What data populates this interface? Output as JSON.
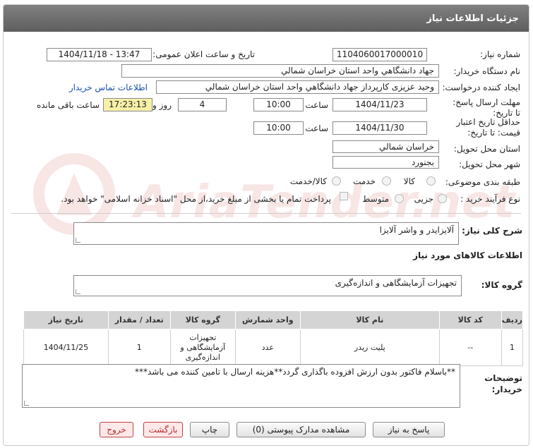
{
  "header": {
    "title": "جزئیات اطلاعات نیاز"
  },
  "fields": {
    "need_number_label": "شماره نیاز:",
    "need_number": "1104060017000010",
    "announce_label": "تاریخ و ساعت اعلان عمومی:",
    "announce_value": "1404/11/18 - 13:47",
    "buyer_org_label": "نام دستگاه خریدار:",
    "buyer_org": "جهاد دانشگاهي واحد استان خراسان شمالي",
    "creator_label": "ایجاد کننده درخواست:",
    "creator": "وحید عزیزی کارپرداز جهاد دانشگاهي واحد استان خراسان شمالي",
    "contact_link": "اطلاعات تماس خریدار",
    "deadline_label": "مهلت ارسال پاسخ: تا تاریخ:",
    "deadline_date": "1404/11/23",
    "time_label": "ساعت",
    "deadline_time": "10:00",
    "days": "4",
    "days_label": "روز و",
    "remaining": "17:23:13",
    "remaining_label": "ساعت باقی مانده",
    "min_validity_label": "حداقل تاریخ اعتبار قیمت: تا تاریخ:",
    "validity_date": "1404/11/30",
    "validity_time": "10:00",
    "province_label": "استان محل تحویل:",
    "province": "خراسان شمالي",
    "city_label": "شهر محل تحویل:",
    "city": "بجنورد",
    "category_label": "طبقه بندی موضوعی:",
    "category_options": [
      "کالا",
      "خدمت",
      "کالا/خدمت"
    ],
    "process_label": "نوع فرآیند خرید :",
    "process_options": [
      "جزیی",
      "متوسط"
    ],
    "payment_note": "پرداخت تمام یا بخشی از مبلغ خرید،از محل \"اسناد خزانه اسلامی\" خواهد بود."
  },
  "watermark": "AriaTender.net",
  "description": {
    "label": "شرح کلی نیاز:",
    "text": "آلایزایدر و واشر آلایزا"
  },
  "goods_info_title": "اطلاعات کالاهای مورد نیاز",
  "goods_group": {
    "label": "گروه کالا:",
    "text": "تجهیزات آزمایشگاهی و اندازه‌گیری"
  },
  "table": {
    "headers": [
      "ردیف",
      "کد کالا",
      "نام کالا",
      "واحد شمارش",
      "گروه کالا",
      "تعداد / مقدار",
      "تاریخ نیاز"
    ],
    "rows": [
      {
        "row": "1",
        "code": "--",
        "name": "پلیت ریدر",
        "unit": "عدد",
        "group": "تجهیزات آزمایشگاهی و اندازه‌گیری",
        "qty": "1",
        "date": "1404/11/25"
      }
    ]
  },
  "buyer_notes": {
    "label": "توضیحات خریدار:",
    "text": "**باسلام فاکتور بدون ارزش افزوده باگذاری گردد**هزینه ارسال با تامین کننده می باشد***"
  },
  "buttons": {
    "reply": "پاسخ به نیاز",
    "docs": "مشاهده مدارک پیوستی (0)",
    "print": "چاپ",
    "back": "بازگشت",
    "exit": "خروج"
  }
}
